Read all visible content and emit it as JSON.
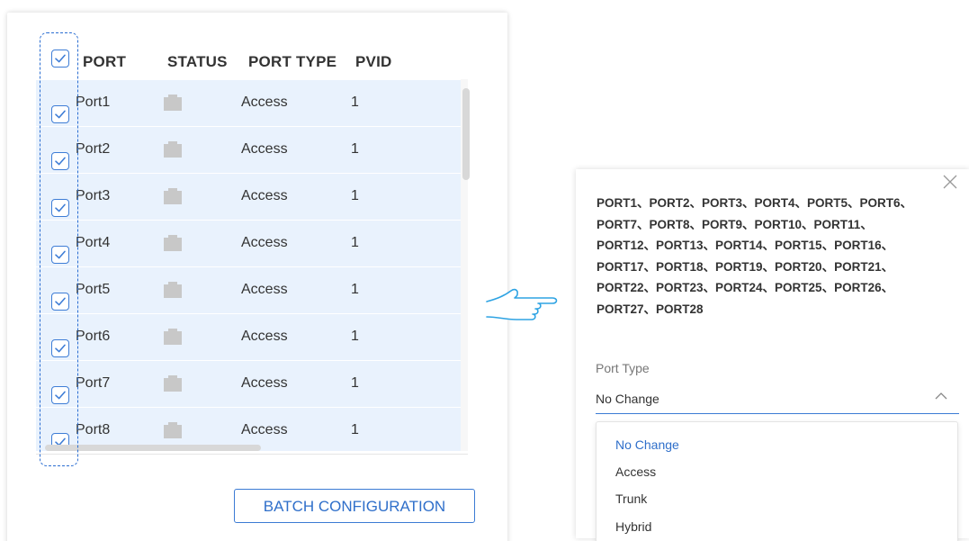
{
  "table": {
    "headers": {
      "port": "PORT",
      "status": "STATUS",
      "port_type": "PORT TYPE",
      "pvid": "PVID"
    },
    "select_all_checked": true,
    "rows": [
      {
        "checked": true,
        "port": "Port1",
        "status_icon": "ethernet-port-icon",
        "type": "Access",
        "pvid": "1"
      },
      {
        "checked": true,
        "port": "Port2",
        "status_icon": "ethernet-port-icon",
        "type": "Access",
        "pvid": "1"
      },
      {
        "checked": true,
        "port": "Port3",
        "status_icon": "ethernet-port-icon",
        "type": "Access",
        "pvid": "1"
      },
      {
        "checked": true,
        "port": "Port4",
        "status_icon": "ethernet-port-icon",
        "type": "Access",
        "pvid": "1"
      },
      {
        "checked": true,
        "port": "Port5",
        "status_icon": "ethernet-port-icon",
        "type": "Access",
        "pvid": "1"
      },
      {
        "checked": true,
        "port": "Port6",
        "status_icon": "ethernet-port-icon",
        "type": "Access",
        "pvid": "1"
      },
      {
        "checked": true,
        "port": "Port7",
        "status_icon": "ethernet-port-icon",
        "type": "Access",
        "pvid": "1"
      },
      {
        "checked": true,
        "port": "Port8",
        "status_icon": "ethernet-port-icon",
        "type": "Access",
        "pvid": "1"
      }
    ]
  },
  "batch_button": {
    "label": "BATCH CONFIGURATION"
  },
  "pointer_icon": "pointing-hand-icon",
  "config_panel": {
    "close_icon": "close-icon",
    "selected_ports_lines": [
      "PORT1、PORT2、PORT3、PORT4、PORT5、PORT6、",
      "PORT7、PORT8、PORT9、PORT10、PORT11、",
      "PORT12、PORT13、PORT14、PORT15、PORT16、",
      "PORT17、PORT18、PORT19、PORT20、PORT21、",
      "PORT22、PORT23、PORT24、PORT25、PORT26、",
      "PORT27、PORT28"
    ],
    "port_type": {
      "label": "Port Type",
      "value": "No Change",
      "chevron_icon": "chevron-up-icon",
      "options": [
        "No Change",
        "Access",
        "Trunk",
        "Hybrid"
      ],
      "selected_option": "No Change"
    }
  },
  "colors": {
    "accent": "#2f6fca",
    "row_background": "#e9f2fd",
    "status_icon": "#c8c8c8"
  }
}
